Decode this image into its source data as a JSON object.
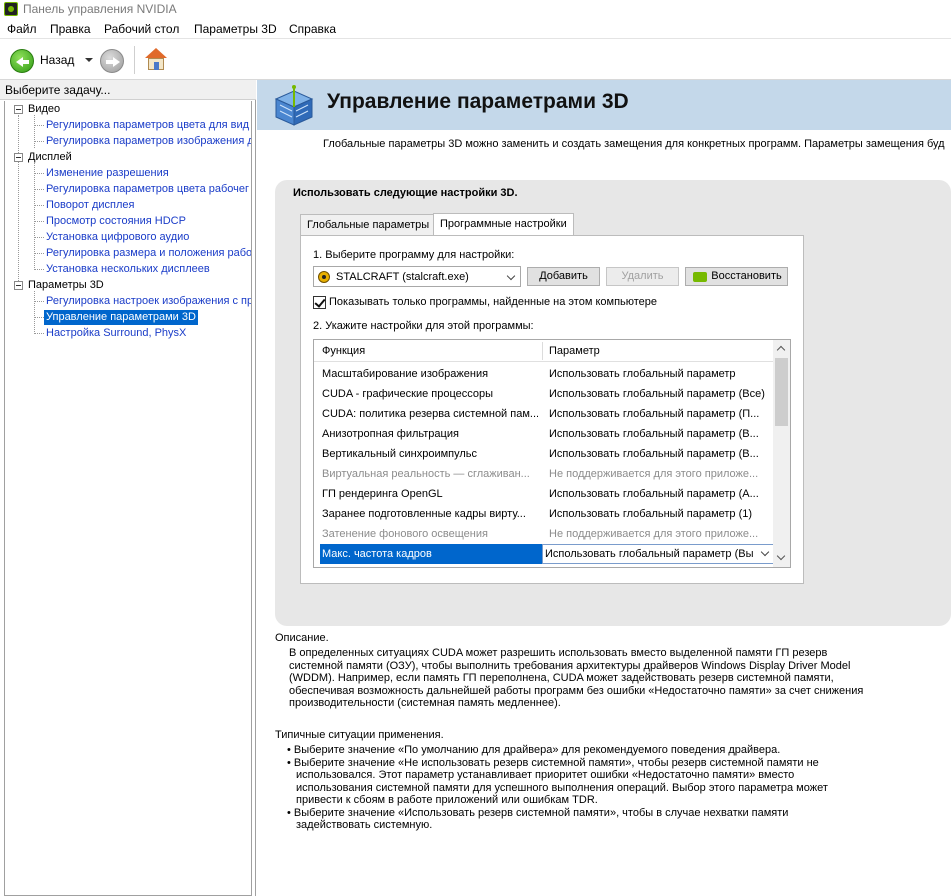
{
  "window": {
    "title": "Панель управления NVIDIA"
  },
  "menu": [
    "Файл",
    "Правка",
    "Рабочий стол",
    "Параметры 3D",
    "Справка"
  ],
  "toolbar": {
    "back_label": "Назад"
  },
  "sidebar": {
    "header": "Выберите задачу...",
    "tree": [
      {
        "label": "Видео",
        "type": "category"
      },
      {
        "label": "Регулировка параметров цвета для вид",
        "type": "leaf"
      },
      {
        "label": "Регулировка параметров изображения д",
        "type": "leaf"
      },
      {
        "label": "Дисплей",
        "type": "category"
      },
      {
        "label": "Изменение разрешения",
        "type": "leaf"
      },
      {
        "label": "Регулировка параметров цвета рабочег",
        "type": "leaf"
      },
      {
        "label": "Поворот дисплея",
        "type": "leaf"
      },
      {
        "label": "Просмотр состояния HDCP",
        "type": "leaf"
      },
      {
        "label": "Установка цифрового аудио",
        "type": "leaf"
      },
      {
        "label": "Регулировка размера и положения рабо",
        "type": "leaf"
      },
      {
        "label": "Установка нескольких дисплеев",
        "type": "leaf"
      },
      {
        "label": "Параметры 3D",
        "type": "category"
      },
      {
        "label": "Регулировка настроек изображения с пр",
        "type": "leaf"
      },
      {
        "label": "Управление параметрами 3D",
        "type": "leaf",
        "selected": true
      },
      {
        "label": "Настройка Surround, PhysX",
        "type": "leaf"
      }
    ]
  },
  "page": {
    "title": "Управление параметрами 3D",
    "subtitle": "Глобальные параметры 3D можно заменить и создать замещения для конкретных программ. Параметры замещения буд",
    "panel_title": "Использовать следующие настройки 3D.",
    "tabs": [
      "Глобальные параметры",
      "Программные настройки"
    ],
    "active_tab": 1,
    "step1": "1. Выберите программу для настройки:",
    "program": "STALCRAFT (stalcraft.exe)",
    "buttons": {
      "add": "Добавить",
      "remove": "Удалить",
      "restore": "Восстановить"
    },
    "show_only_label": "Показывать только программы, найденные на этом компьютере",
    "step2": "2. Укажите настройки для этой программы:",
    "grid": {
      "headers": [
        "Функция",
        "Параметр"
      ],
      "rows": [
        {
          "fn": "Масштабирование изображения",
          "val": "Использовать глобальный параметр"
        },
        {
          "fn": "CUDA - графические процессоры",
          "val": "Использовать глобальный параметр (Все)"
        },
        {
          "fn": "CUDA: политика резерва системной пам...",
          "val": "Использовать глобальный параметр (П..."
        },
        {
          "fn": "Анизотропная фильтрация",
          "val": "Использовать глобальный параметр (В..."
        },
        {
          "fn": "Вертикальный синхроимпульс",
          "val": "Использовать глобальный параметр (В..."
        },
        {
          "fn": "Виртуальная реальность — сглаживан...",
          "val": "Не поддерживается для этого приложе...",
          "disabled": true
        },
        {
          "fn": "ГП рендеринга OpenGL",
          "val": "Использовать глобальный параметр (А..."
        },
        {
          "fn": "Заранее подготовленные кадры вирту...",
          "val": "Использовать глобальный параметр (1)"
        },
        {
          "fn": "Затенение фонового освещения",
          "val": "Не поддерживается для этого приложе...",
          "disabled": true
        },
        {
          "fn": "Макс. частота кадров",
          "val": "Использовать глобальный параметр (Вы",
          "selected": true
        }
      ]
    },
    "description_label": "Описание.",
    "description": "В определенных ситуациях CUDA может разрешить использовать вместо выделенной памяти ГП резерв системной памяти (ОЗУ), чтобы выполнить требования архитектуры драйверов Windows Display Driver Model (WDDM). Например, если память ГП переполнена, CUDA может задействовать резерв системной памяти, обеспечивая возможность дальнейшей работы программ без ошибки «Недостаточно памяти» за счет снижения производительности (системная память медленнее).",
    "typical_label": "Типичные ситуации применения.",
    "typical": [
      "• Выберите значение «По умолчанию для драйвера» для рекомендуемого поведения драйвера.",
      "• Выберите значение «Не использовать резерв системной памяти», чтобы резерв системной памяти не использовался. Этот параметр устанавливает приоритет ошибки «Недостаточно памяти» вместо использования системной памяти для успешного выполнения операций. Выбор этого параметра может привести к сбоям в работе приложений или ошибкам TDR.",
      "• Выберите значение «Использовать резерв системной памяти», чтобы в случае нехватки памяти задействовать системную."
    ]
  },
  "colors": {
    "banner": "#c4d8ea",
    "selection": "#0066cc",
    "link": "#1a3cc8",
    "nvidia_green": "#76b900"
  }
}
